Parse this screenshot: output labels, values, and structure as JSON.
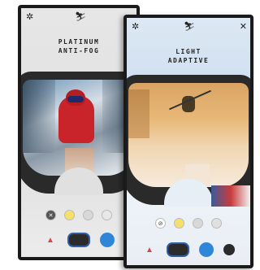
{
  "left_screen": {
    "title_line1": "PLATINUM",
    "title_line2": "ANTI-FOG",
    "gear_glyph": "✲",
    "skier_glyph": "⛷"
  },
  "right_screen": {
    "title_line1": "LIGHT",
    "title_line2": "ADAPTIVE",
    "gear_glyph": "✲",
    "skier_glyph": "⛷",
    "close_glyph": "✕"
  },
  "colors": {
    "accent_blue": "#2f86d8",
    "goggle_frame": "#2a2a2a"
  }
}
